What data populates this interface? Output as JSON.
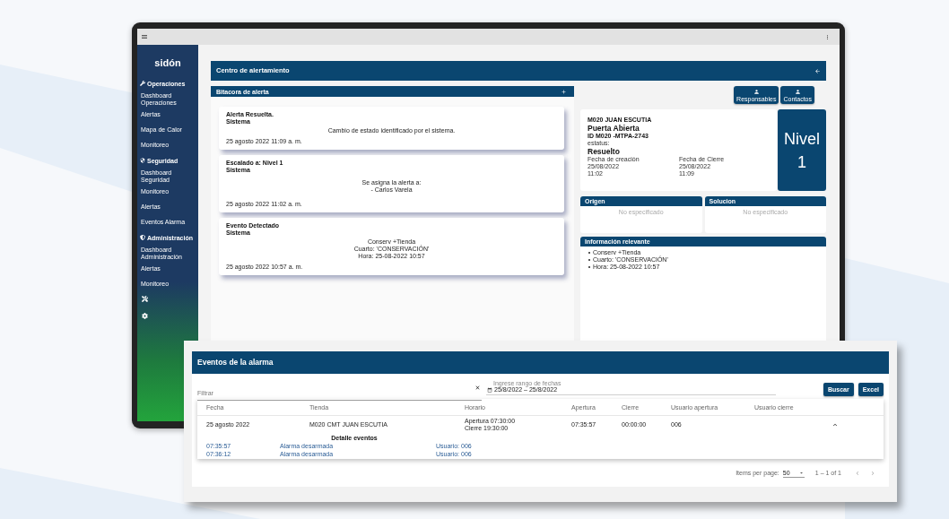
{
  "device": {
    "sidebar": {
      "logo": "sidón",
      "sections": [
        {
          "title": "Operaciones",
          "items": [
            "Dashboard Operaciones",
            "Alertas",
            "Mapa de Calor",
            "Monitoreo"
          ]
        },
        {
          "title": "Seguridad",
          "items": [
            "Dashboard Seguridad",
            "Monitoreo",
            "Alertas",
            "Eventos Alarma"
          ]
        },
        {
          "title": "Administración",
          "items": [
            "Dashboard Administración",
            "Alertas",
            "Monitoreo"
          ]
        }
      ]
    },
    "page_header": {
      "title": "Centro de alertamiento"
    },
    "alert_log": {
      "title": "Bitacora de alerta",
      "entries": [
        {
          "title": "Alerta Resuelta.",
          "author": "Sistema",
          "message": [
            "Cambio de estado identificado por el sistema."
          ],
          "date": "25 agosto 2022 11:09 a. m."
        },
        {
          "title": "Escalado a: Nivel 1",
          "author": "Sistema",
          "message": [
            "Se asigna la alerta a:",
            "- Carlos Varela"
          ],
          "date": "25 agosto 2022 11:02 a. m."
        },
        {
          "title": "Evento Detectado",
          "author": "Sistema",
          "message": [
            "Conserv +Tienda",
            "Cuarto: 'CONSERVACIÓN'",
            "Hora: 25-08-2022 10:57"
          ],
          "date": "25 agosto 2022 10:57 a. m."
        }
      ]
    },
    "alert_detail": {
      "buttons": [
        "Responsables",
        "Contactos"
      ],
      "store": "M020 JUAN ESCUTIA",
      "title": "Puerta Abierta",
      "id": "ID M020 -MTPA-2743",
      "status_label": "estatus:",
      "status": "Resuelto",
      "dates": [
        {
          "label": "Fecha de creación",
          "date": "25/08/2022",
          "time": "11:02"
        },
        {
          "label": "Fecha de Cierre",
          "date": "25/08/2022",
          "time": "11:09"
        }
      ],
      "priority": {
        "label": "Nivel",
        "value": "1"
      }
    },
    "panels": [
      {
        "title": "Origen",
        "text": "No especificado"
      },
      {
        "title": "Solucion",
        "text": "No especificado"
      }
    ],
    "relevant_info": {
      "title": "Información relevante",
      "items": [
        "Conserv +Tienda",
        "Cuarto: 'CONSERVACIÓN'",
        "Hora: 25-08-2022 10:57"
      ]
    }
  },
  "events_window": {
    "title": "Eventos de la alarma",
    "filter": {
      "placeholder": "Filtrar"
    },
    "date_range": {
      "label": "Ingrese rango de fechas",
      "value": "25/8/2022 – 25/8/2022"
    },
    "buttons": [
      "Buscar",
      "Excel"
    ],
    "table": {
      "columns": [
        "Fecha",
        "Tienda",
        "Horario",
        "Apertura",
        "Cierre",
        "Usuario apertura",
        "Usuario cierre"
      ],
      "rows": [
        {
          "expanded": true,
          "cells": [
            [
              "25 agosto 2022"
            ],
            [
              "M020 CMT JUAN ESCUTIA"
            ],
            [
              "Apertura 07:30:00",
              "Cierre 19:30:00"
            ],
            [
              "07:35:57"
            ],
            [
              "00:00:00"
            ],
            [
              "006"
            ]
          ],
          "detail_title": "Detalle eventos",
          "details": [
            {
              "time": "07:35:57",
              "event": "Alarma desarmada",
              "user": "Usuario: 006"
            },
            {
              "time": "07:36:12",
              "event": "Alarma desarmada",
              "user": "Usuario: 006"
            }
          ]
        }
      ]
    },
    "paginator": {
      "label": "Items per page:",
      "page_size": "50",
      "range": "1 – 1 of 1"
    }
  }
}
